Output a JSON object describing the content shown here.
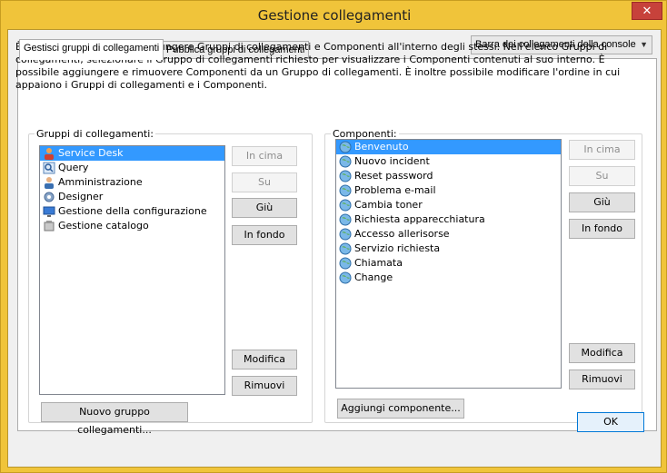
{
  "window": {
    "title": "Gestione collegamenti",
    "close_label": "✕"
  },
  "tabs": [
    {
      "label": "Gestisci gruppi di collegamenti",
      "active": true
    },
    {
      "label": "Pubblica gruppi di collegamenti",
      "active": false
    }
  ],
  "toolbar_combo": {
    "value": "Barra dei collegamenti della console"
  },
  "description": "È possibile modificare e aggiungere Gruppi di collegamenti e Componenti all'interno degli stessi. Nell'elenco Gruppi di collegamenti, selezionare il Gruppo di collegamenti richiesto per visualizzare i Componenti contenuti al suo interno. È possibile aggiungere e rimuovere Componenti da un Gruppo di collegamenti. È inoltre possibile modificare l'ordine in cui appaiono i Gruppi di collegamenti e i Componenti.",
  "groups_panel": {
    "label": "Gruppi di collegamenti:",
    "items": [
      {
        "label": "Service Desk",
        "icon": "service-desk-icon",
        "selected": true
      },
      {
        "label": "Query",
        "icon": "query-icon",
        "selected": false
      },
      {
        "label": "Amministrazione",
        "icon": "admin-icon",
        "selected": false
      },
      {
        "label": "Designer",
        "icon": "designer-icon",
        "selected": false
      },
      {
        "label": "Gestione della configurazione",
        "icon": "monitor-icon",
        "selected": false
      },
      {
        "label": "Gestione catalogo",
        "icon": "catalog-icon",
        "selected": false
      }
    ],
    "buttons": {
      "top": "In cima",
      "up": "Su",
      "down": "Giù",
      "bottom": "In fondo",
      "edit": "Modifica",
      "remove": "Rimuovi"
    },
    "new_button": "Nuovo gruppo collegamenti..."
  },
  "components_panel": {
    "label": "Componenti:",
    "items": [
      {
        "label": "Benvenuto",
        "icon": "globe-icon",
        "selected": true
      },
      {
        "label": "Nuovo incident",
        "icon": "globe-icon",
        "selected": false
      },
      {
        "label": "Reset password",
        "icon": "globe-icon",
        "selected": false
      },
      {
        "label": "Problema e-mail",
        "icon": "globe-icon",
        "selected": false
      },
      {
        "label": "Cambia toner",
        "icon": "globe-icon",
        "selected": false
      },
      {
        "label": "Richiesta apparecchiatura",
        "icon": "globe-icon",
        "selected": false
      },
      {
        "label": "Accesso allerisorse",
        "icon": "globe-icon",
        "selected": false
      },
      {
        "label": "Servizio richiesta",
        "icon": "globe-icon",
        "selected": false
      },
      {
        "label": "Chiamata",
        "icon": "globe-icon",
        "selected": false
      },
      {
        "label": "Change",
        "icon": "globe-icon",
        "selected": false
      }
    ],
    "buttons": {
      "top": "In cima",
      "up": "Su",
      "down": "Giù",
      "bottom": "In fondo",
      "edit": "Modifica",
      "remove": "Rimuovi"
    },
    "add_button": "Aggiungi componente..."
  },
  "footer": {
    "ok_label": "OK"
  },
  "colors": {
    "frame": "#f0c43a",
    "selection": "#3399ff",
    "close": "#c7423b"
  }
}
